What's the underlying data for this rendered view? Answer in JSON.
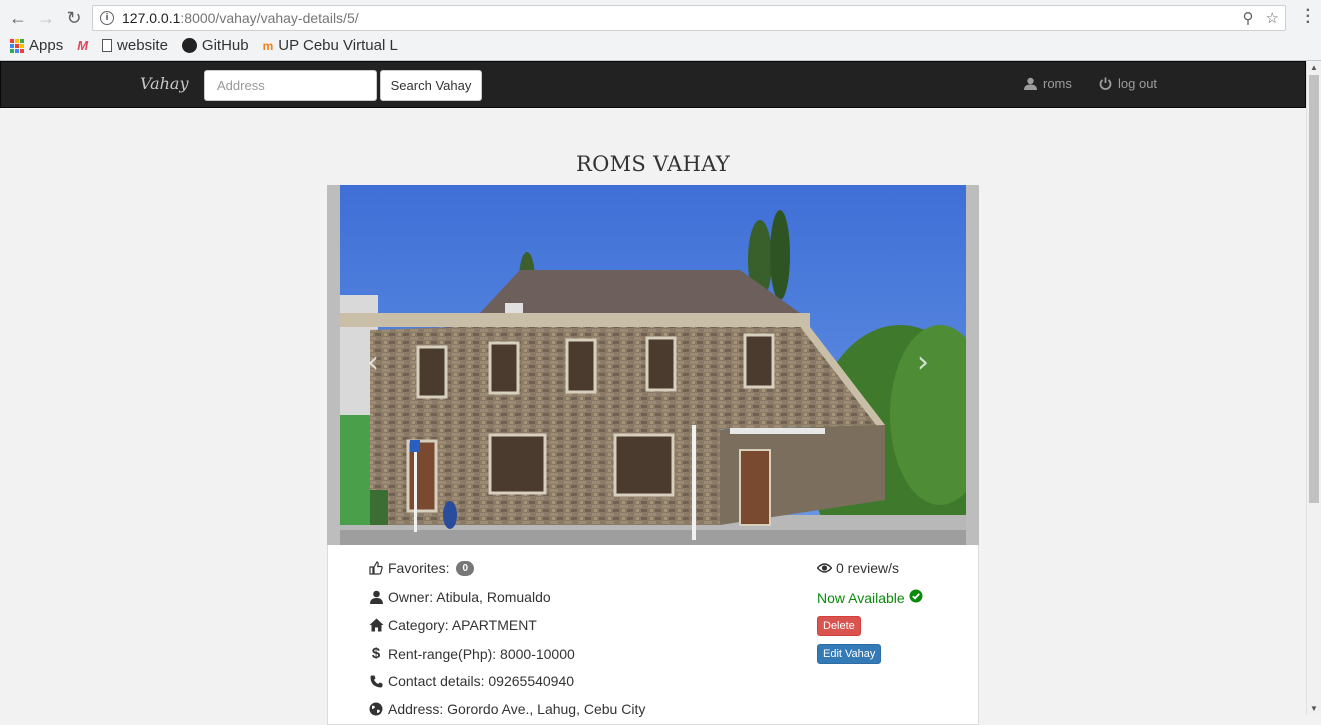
{
  "browser": {
    "url_host": "127.0.0.1",
    "url_path": ":8000/vahay/vahay-details/5/",
    "bookmarks": [
      {
        "label": "Apps",
        "icon": "apps-grid-icon"
      },
      {
        "label": "",
        "icon": "m-logo-icon"
      },
      {
        "label": "website",
        "icon": "page-icon"
      },
      {
        "label": "GitHub",
        "icon": "github-icon"
      },
      {
        "label": "UP Cebu Virtual L",
        "icon": "moodle-icon"
      }
    ]
  },
  "navbar": {
    "brand": "Vahay",
    "search_placeholder": "Address",
    "search_button": "Search Vahay",
    "user_label": "roms",
    "logout_label": "log out"
  },
  "listing": {
    "title": "ROMS VAHAY",
    "favorites_label": "Favorites:",
    "favorites_count": "0",
    "owner": "Owner: Atibula, Romualdo",
    "category": "Category: APARTMENT",
    "rent_range": "Rent-range(Php): 8000-10000",
    "contact": "Contact details: 09265540940",
    "address": "Address: Gorordo Ave., Lahug, Cebu City",
    "reviews": "0 review/s",
    "availability": "Now Available",
    "delete_button": "Delete",
    "edit_button": "Edit Vahay"
  },
  "colors": {
    "navbar_bg": "#222222",
    "available_green": "#0a8a0a",
    "danger": "#d9534f",
    "primary": "#337ab7"
  }
}
